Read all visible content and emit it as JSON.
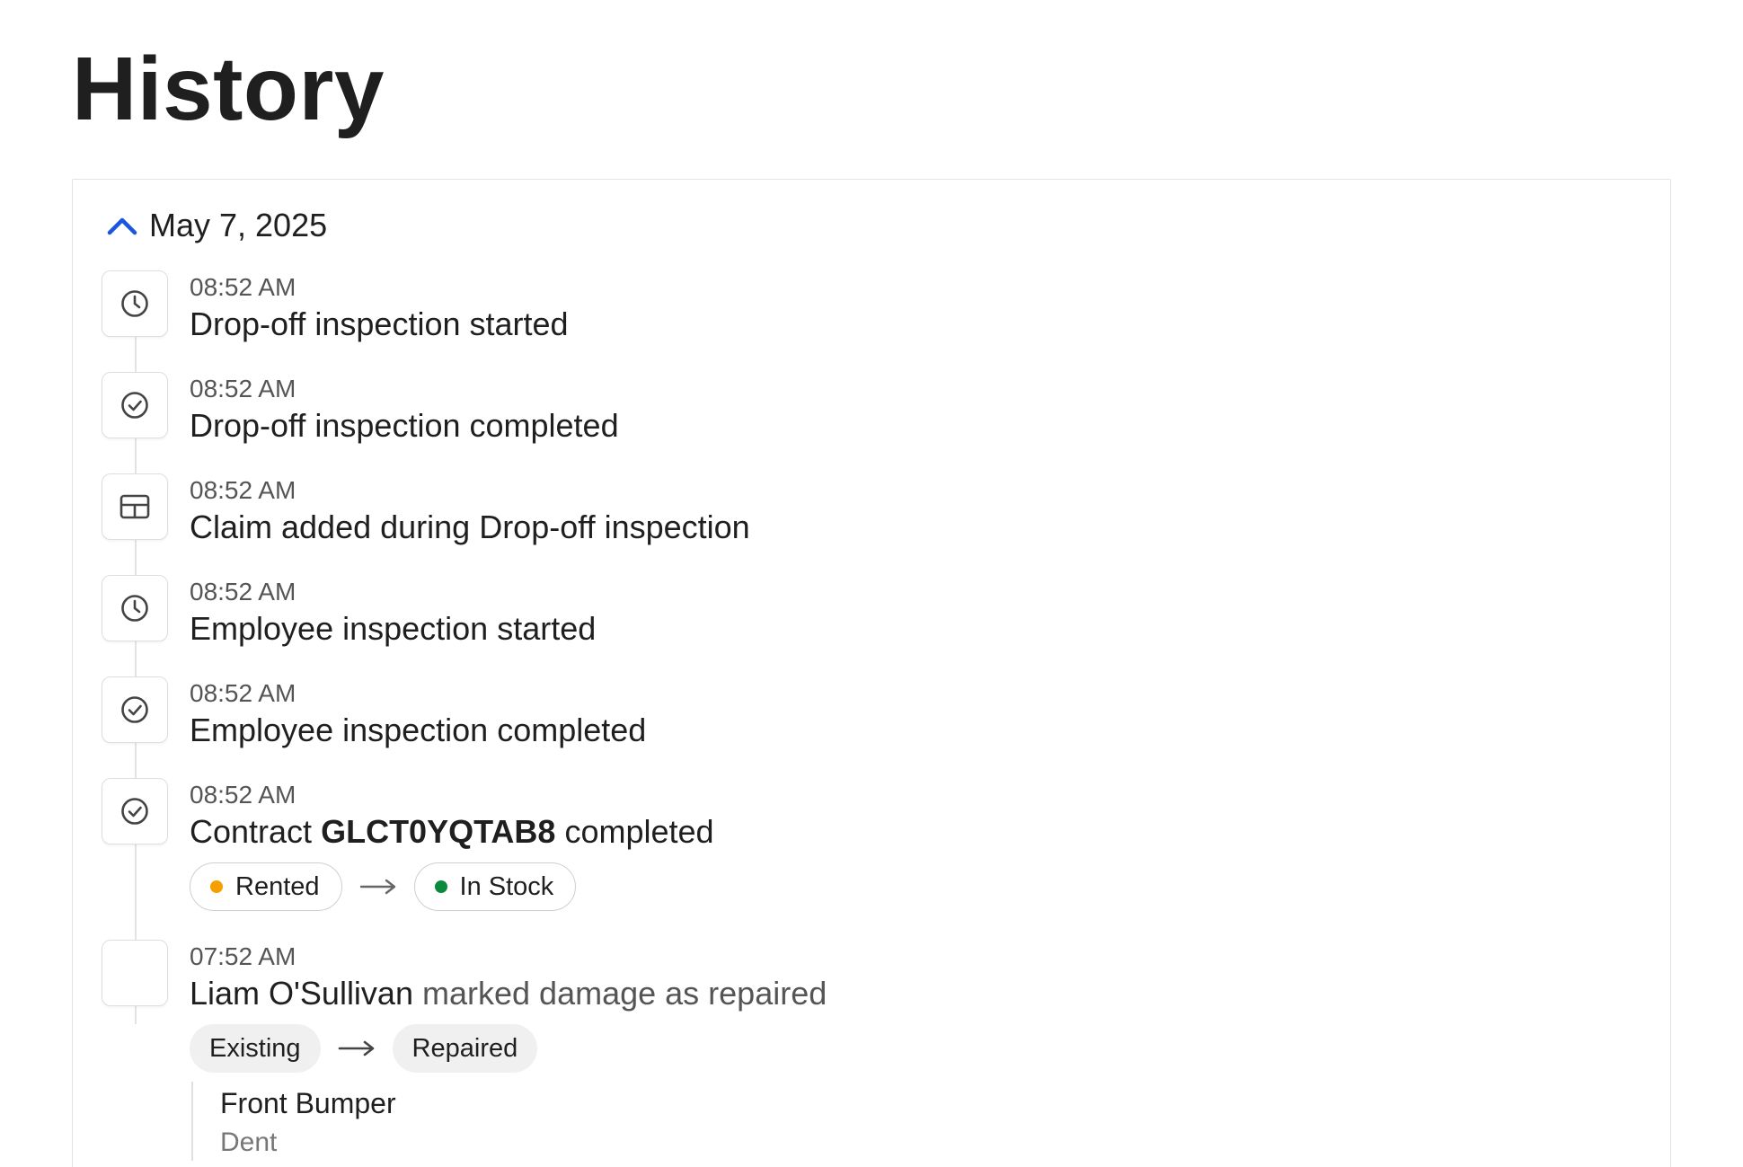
{
  "page": {
    "title": "History"
  },
  "group": {
    "date": "May 7, 2025",
    "expanded": true
  },
  "events": [
    {
      "time": "08:52 AM",
      "text": "Drop-off inspection started",
      "icon": "clock-icon"
    },
    {
      "time": "08:52 AM",
      "text": "Drop-off inspection completed",
      "icon": "check-circle-icon"
    },
    {
      "time": "08:52 AM",
      "text": "Claim added during Drop-off inspection",
      "icon": "table-icon"
    },
    {
      "time": "08:52 AM",
      "text": "Employee inspection started",
      "icon": "clock-icon"
    },
    {
      "time": "08:52 AM",
      "text": "Employee inspection completed",
      "icon": "check-circle-icon"
    },
    {
      "time": "08:52 AM",
      "text_prefix": "Contract",
      "contract_id": "GLCT0YQTAB8",
      "text_suffix": "completed",
      "icon": "check-circle-icon",
      "status_from": {
        "label": "Rented",
        "color": "#f5a000"
      },
      "status_to": {
        "label": "In Stock",
        "color": "#0a8a3a"
      }
    },
    {
      "time": "07:52 AM",
      "actor": "Liam O'Sullivan",
      "action": "marked damage as repaired",
      "state_from": "Existing",
      "state_to": "Repaired",
      "damage_part": "Front Bumper",
      "damage_type": "Dent"
    }
  ],
  "colors": {
    "accent": "#1a56e0",
    "border": "#e3e3e3",
    "text": "#1f1f1f",
    "muted": "#555555"
  }
}
